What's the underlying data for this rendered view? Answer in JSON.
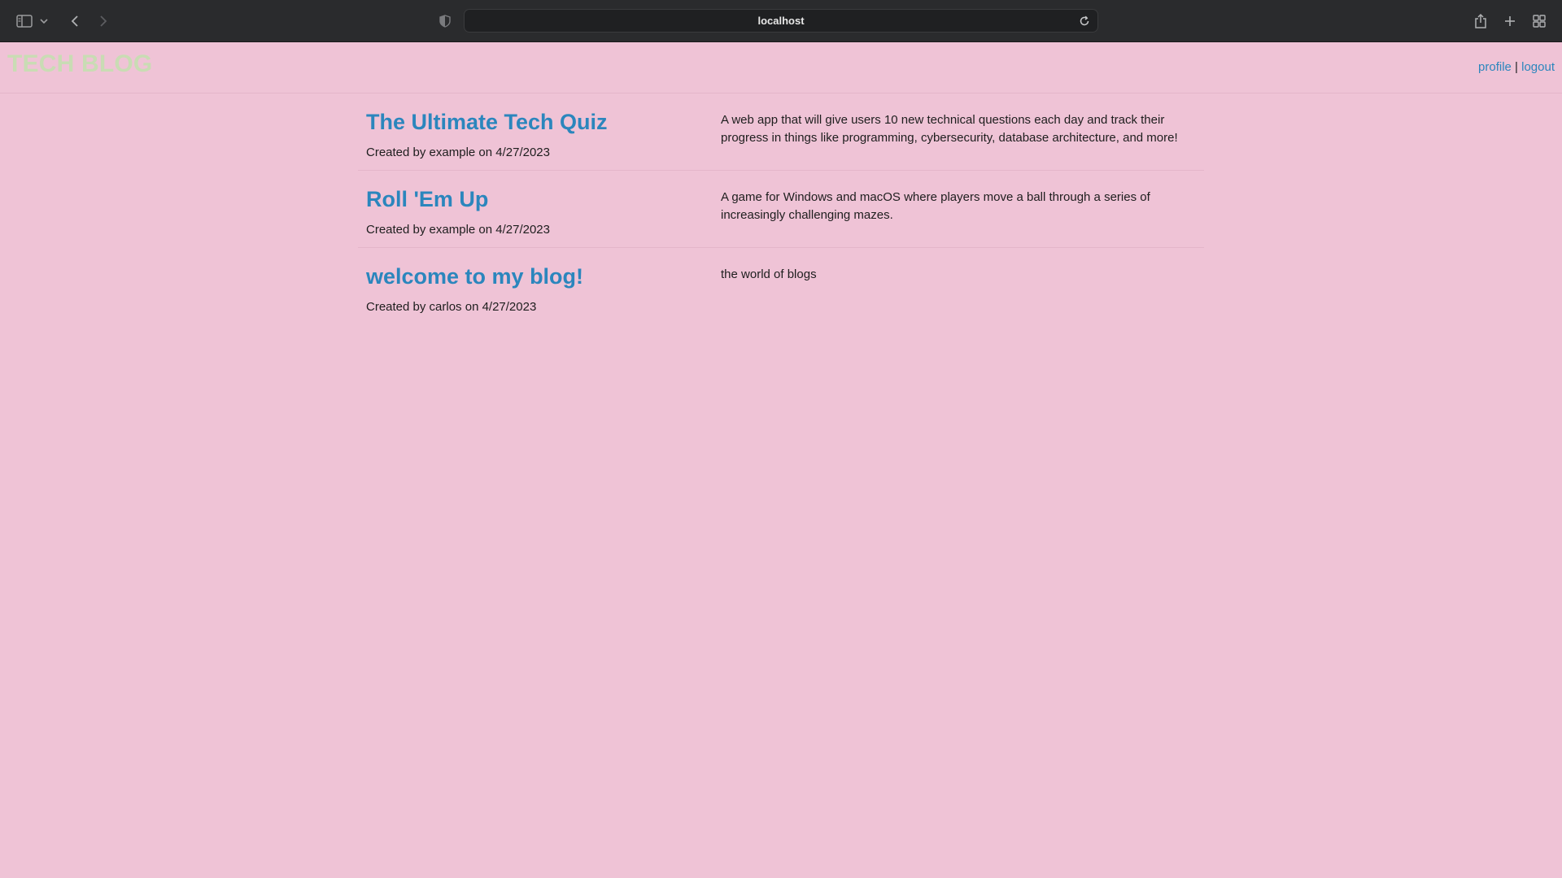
{
  "browser": {
    "url": "localhost",
    "icons": [
      "sidebar-icon",
      "chevron-down-icon",
      "back-icon",
      "forward-icon",
      "shield-icon",
      "reload-icon",
      "share-icon",
      "new-tab-icon",
      "tab-overview-icon"
    ],
    "colors": {
      "chrome_bg": "#2a2b2d",
      "url_bg": "#1f2022"
    }
  },
  "header": {
    "logo": "TECH BLOG",
    "nav": {
      "profile": "profile",
      "separator": "|",
      "logout": "logout"
    }
  },
  "posts": [
    {
      "title": "The Ultimate Tech Quiz",
      "meta": "Created by example on 4/27/2023",
      "description": "A web app that will give users 10 new technical questions each day and track their progress in things like programming, cybersecurity, database architecture, and more!"
    },
    {
      "title": "Roll 'Em Up",
      "meta": "Created by example on 4/27/2023",
      "description": "A game for Windows and macOS where players move a ball through a series of increasingly challenging mazes."
    },
    {
      "title": "welcome to my blog!",
      "meta": "Created by carlos on 4/27/2023",
      "description": "the world of blogs"
    }
  ],
  "colors": {
    "page_bg": "#efc3d6",
    "link": "#2b86bd",
    "logo": "#c9dcb4"
  }
}
